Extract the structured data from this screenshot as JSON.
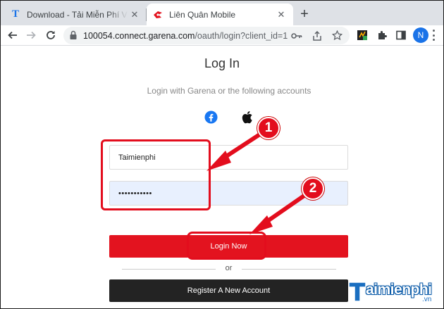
{
  "browser": {
    "tabs": [
      {
        "title": "Download - Tải Miễn Phí VN - Ph",
        "active": false
      },
      {
        "title": "Liên Quân Mobile",
        "active": true
      }
    ],
    "url": {
      "host": "100054.connect.garena.com",
      "path": "/oauth/login?client_id=1..."
    },
    "profile_initial": "N"
  },
  "page": {
    "title": "Log In",
    "subtitle": "Login with Garena or the following accounts",
    "social_icons": [
      "facebook-icon",
      "apple-icon"
    ],
    "username_value": "Taimienphi",
    "password_value": "•••••••••••",
    "login_label": "Login Now",
    "or_label": "or",
    "register_label": "Register A New Account"
  },
  "annotations": {
    "step1": "1",
    "step2": "2",
    "color": "#e30d1d"
  },
  "watermark": {
    "brand": "aimienphi",
    "tld": ".vn"
  },
  "colors": {
    "login_button": "#e3131f",
    "register_button": "#232323",
    "password_fill": "#e8f0fe"
  }
}
